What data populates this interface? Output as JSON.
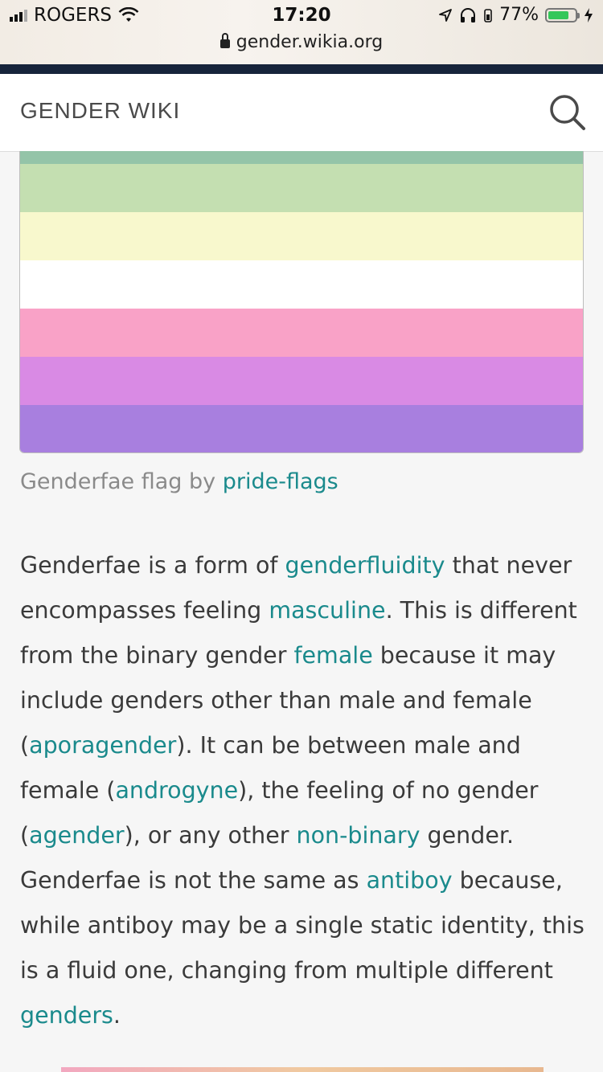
{
  "status_bar": {
    "carrier": "ROGERS",
    "time": "17:20",
    "url": "gender.wikia.org",
    "battery_percent": "77%",
    "battery_level": 0.77
  },
  "header": {
    "site_title": "GENDER WIKI",
    "search_icon": "search-icon"
  },
  "flag": {
    "stripes": [
      "#94c4a8",
      "#c4dfb1",
      "#f8f8cd",
      "#ffffff",
      "#f9a2c7",
      "#d98ae4",
      "#a87fdf"
    ]
  },
  "caption": {
    "text": "Genderfae flag by ",
    "link": "pride-flags"
  },
  "article": {
    "t1": "Genderfae is a form of ",
    "l1": "genderfluidity",
    "t2": " that never encompasses feeling ",
    "l2": "masculine",
    "t3": ". This is different from the binary gender ",
    "l3": "female",
    "t4": " because it may include genders other than male and female (",
    "l4": "aporagender",
    "t5": "). It can be between male and female (",
    "l5": "androgyne",
    "t6": "), the feeling of no gender (",
    "l6": "agender",
    "t7": "), or any other ",
    "l7": "non-binary",
    "t8": " gender. Genderfae is not the same as ",
    "l8": "antiboy",
    "t9": " because, while antiboy may be a single static identity, this is a fluid one, changing from multiple different ",
    "l9": "genders",
    "t10": "."
  },
  "colors": {
    "link": "#1a8a8c",
    "header_bar": "#17243b"
  }
}
